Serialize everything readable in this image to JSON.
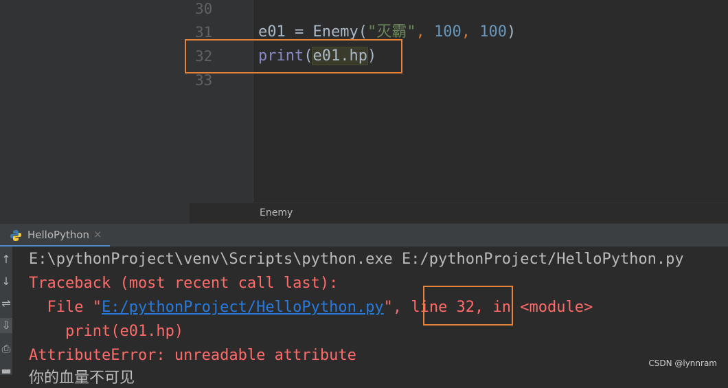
{
  "editor": {
    "lines": [
      {
        "num": "30"
      },
      {
        "num": "31"
      },
      {
        "num": "32"
      },
      {
        "num": "33"
      }
    ],
    "code31": {
      "a": "e01 = Enemy(",
      "str": "\"灭霸\"",
      "comma1": ", ",
      "n1": "100",
      "comma2": ", ",
      "n2": "100",
      "close": ")"
    },
    "code32": {
      "fn": "print",
      "open": "(",
      "arg": "e01.hp",
      "close": ")"
    }
  },
  "breadcrumb": {
    "label": "Enemy"
  },
  "run_tab": {
    "label": "HelloPython",
    "close": "×",
    "icon": "python-icon"
  },
  "toolbar": {
    "up": "↑",
    "down": "↓",
    "wrap": "⇌",
    "scroll": "⇩",
    "print": "⎙",
    "trash": "▬"
  },
  "console": {
    "line1": "E:\\pythonProject\\venv\\Scripts\\python.exe E:/pythonProject/HelloPython.py",
    "line2": "Traceback (most recent call last):",
    "line3_pre": "  File \"",
    "line3_link": "E:/pythonProject/HelloPython.py",
    "line3_mid": "\", ",
    "line3_box": "line 32,",
    "line3_post": " in <module>",
    "line4": "    print(e01.hp)",
    "line5": "AttributeError: unreadable attribute",
    "line6": "你的血量不可见"
  },
  "watermark": "CSDN @lynnram",
  "colors": {
    "highlight_box": "#e8833a",
    "error": "#ff6b68",
    "link": "#287bde"
  }
}
